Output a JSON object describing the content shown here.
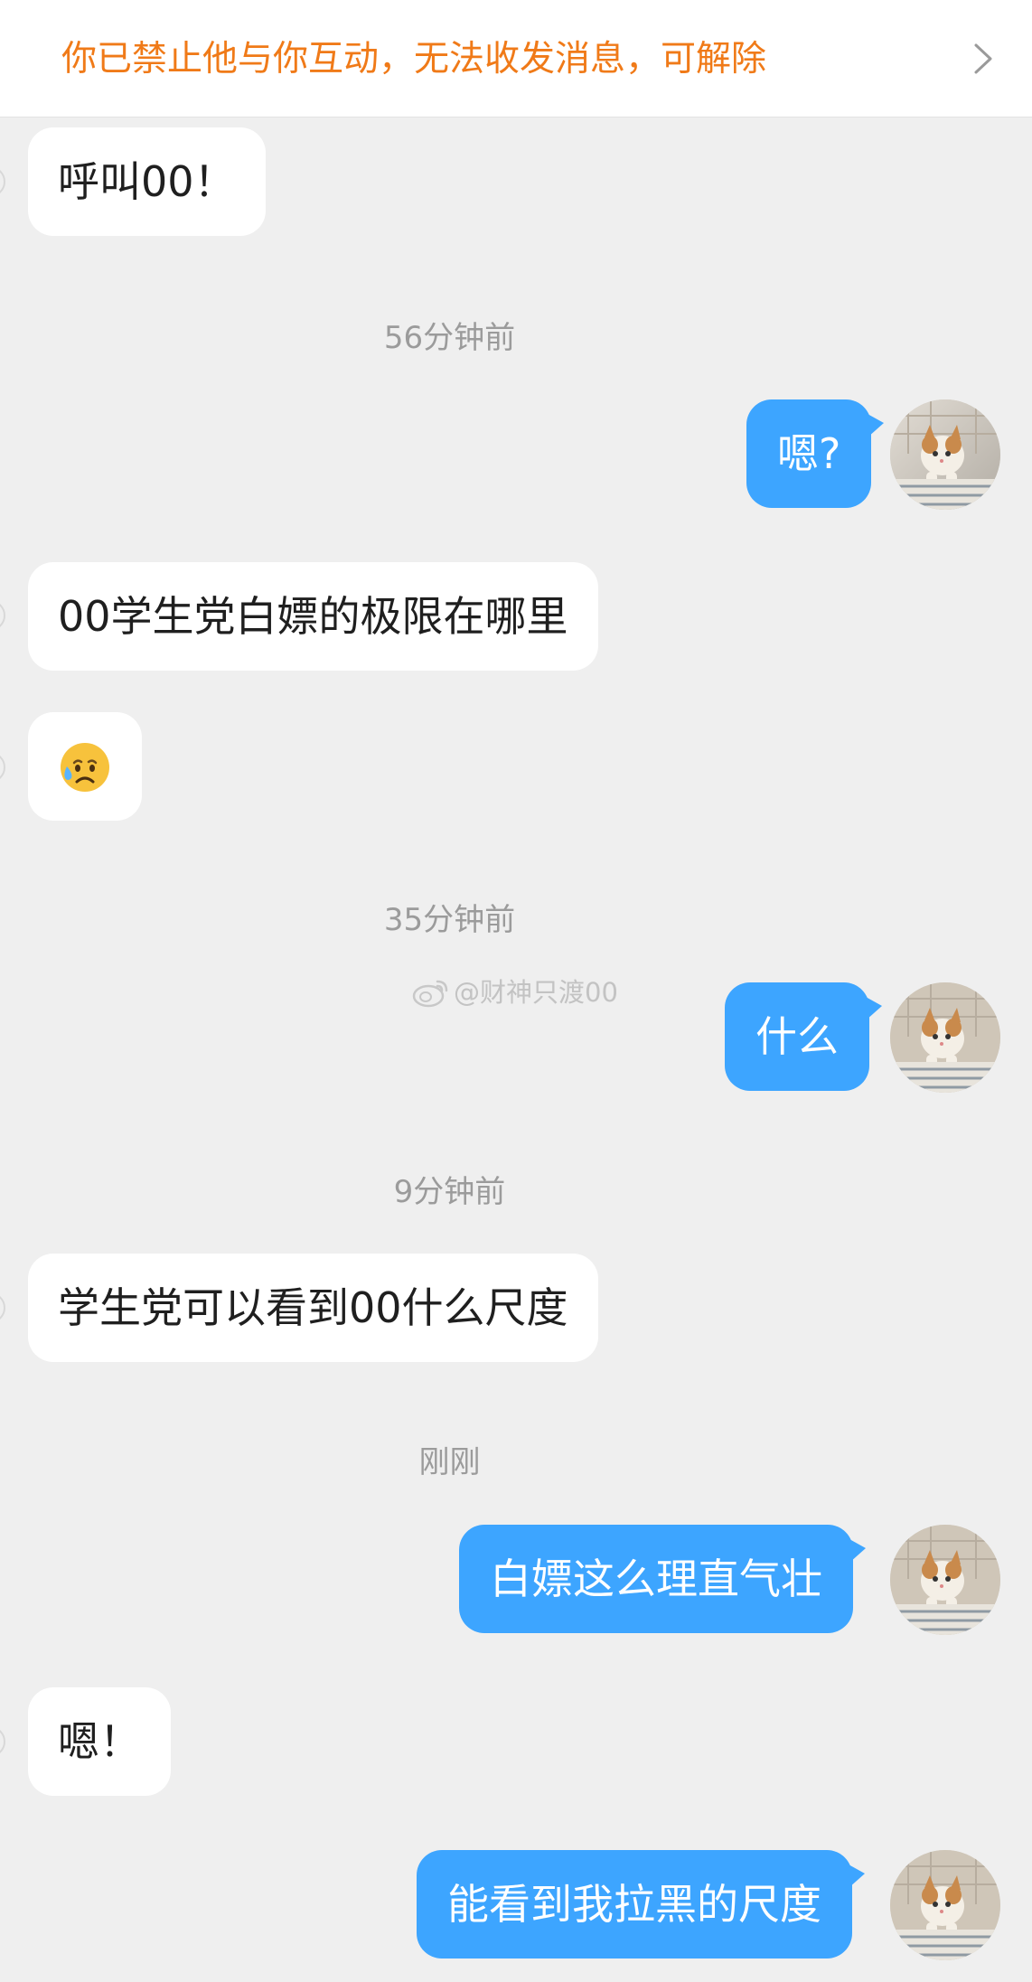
{
  "banner": {
    "notice": "你已禁止他与你互动，无法收发消息，可解除",
    "chevron_icon": "chevron-right-icon"
  },
  "messages": [
    {
      "side": "in",
      "text": "呼叫00！"
    },
    {
      "side": "time",
      "text": "56分钟前"
    },
    {
      "side": "out",
      "text": "嗯?"
    },
    {
      "side": "in",
      "text": "00学生党白嫖的极限在哪里"
    },
    {
      "side": "in",
      "emoji": "sad-sweat-face-icon"
    },
    {
      "side": "time",
      "text": "35分钟前"
    },
    {
      "side": "out",
      "text": "什么"
    },
    {
      "side": "time",
      "text": "9分钟前"
    },
    {
      "side": "in",
      "text": "学生党可以看到00什么尺度"
    },
    {
      "side": "time",
      "text": "刚刚"
    },
    {
      "side": "out",
      "text": "白嫖这么理直气壮"
    },
    {
      "side": "in",
      "text": "嗯！"
    },
    {
      "side": "out",
      "text": "能看到我拉黑的尺度"
    }
  ],
  "watermark": {
    "text": "@财神只渡00",
    "icon": "weibo-logo-icon"
  },
  "colors": {
    "outgoing_bubble": "#3da5ff",
    "incoming_bubble": "#ffffff",
    "background": "#efefef",
    "banner_text": "#f07a18"
  }
}
